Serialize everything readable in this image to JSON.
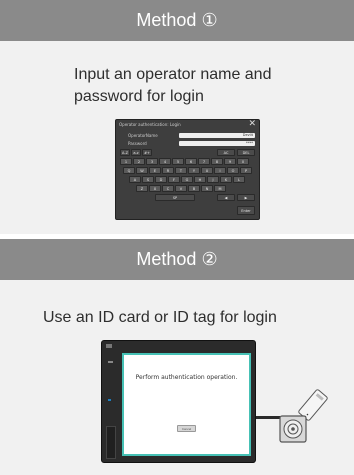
{
  "method1": {
    "title": "Method ①",
    "caption_line1": "Input an operator name and",
    "caption_line2": "password for login",
    "dialog": {
      "title": "Operator authentication: Login",
      "close_icon": "close-icon",
      "operator_label": "OperatorName",
      "operator_value": "Devlit",
      "password_label": "Password",
      "password_value": "****",
      "keyboard_row1": [
        "A-Z",
        "a-z",
        "#+",
        "AC",
        "DEL"
      ],
      "keyboard_row2": [
        "1",
        "2",
        "3",
        "4",
        "5",
        "6",
        "7",
        "8",
        "9",
        "0"
      ],
      "keyboard_row3": [
        "Q",
        "W",
        "E",
        "R",
        "T",
        "Y",
        "U",
        "I",
        "O",
        "P"
      ],
      "keyboard_row4": [
        "A",
        "S",
        "D",
        "F",
        "G",
        "H",
        "J",
        "K",
        "L"
      ],
      "keyboard_row5": [
        "Z",
        "X",
        "C",
        "V",
        "B",
        "N",
        "M"
      ],
      "space_label": "SP",
      "left_arrow": "◀",
      "right_arrow": "▶",
      "enter_label": "Enter"
    }
  },
  "method2": {
    "title": "Method ②",
    "caption": "Use an ID card or ID tag for login",
    "screen_message": "Perform authentication operation.",
    "screen_button": "Cancel"
  },
  "colors": {
    "header_bg": "#8a8a8a",
    "panel_bg": "#f1f1f1",
    "screen_border": "#46c1b5"
  }
}
